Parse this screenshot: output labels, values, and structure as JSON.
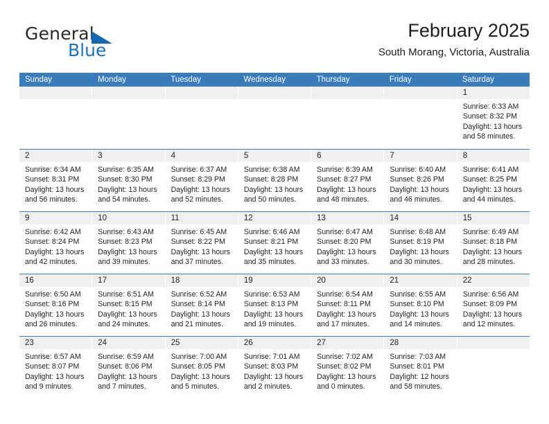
{
  "brand": {
    "word_general": "General",
    "word_blue": "Blue",
    "triangle_icon": "triangle-icon",
    "accent_color": "#1b72bb"
  },
  "header": {
    "title": "February 2025",
    "subtitle": "South Morang, Victoria, Australia"
  },
  "calendar": {
    "header_bg": "#3a7cba",
    "daynum_bg": "#efefef",
    "weekday_headers": [
      "Sunday",
      "Monday",
      "Tuesday",
      "Wednesday",
      "Thursday",
      "Friday",
      "Saturday"
    ],
    "weeks": [
      [
        {
          "day": "",
          "sunrise": "",
          "sunset": "",
          "daylight": "",
          "daylight2": ""
        },
        {
          "day": "",
          "sunrise": "",
          "sunset": "",
          "daylight": "",
          "daylight2": ""
        },
        {
          "day": "",
          "sunrise": "",
          "sunset": "",
          "daylight": "",
          "daylight2": ""
        },
        {
          "day": "",
          "sunrise": "",
          "sunset": "",
          "daylight": "",
          "daylight2": ""
        },
        {
          "day": "",
          "sunrise": "",
          "sunset": "",
          "daylight": "",
          "daylight2": ""
        },
        {
          "day": "",
          "sunrise": "",
          "sunset": "",
          "daylight": "",
          "daylight2": ""
        },
        {
          "day": "1",
          "sunrise": "Sunrise: 6:33 AM",
          "sunset": "Sunset: 8:32 PM",
          "daylight": "Daylight: 13 hours",
          "daylight2": "and 58 minutes."
        }
      ],
      [
        {
          "day": "2",
          "sunrise": "Sunrise: 6:34 AM",
          "sunset": "Sunset: 8:31 PM",
          "daylight": "Daylight: 13 hours",
          "daylight2": "and 56 minutes."
        },
        {
          "day": "3",
          "sunrise": "Sunrise: 6:35 AM",
          "sunset": "Sunset: 8:30 PM",
          "daylight": "Daylight: 13 hours",
          "daylight2": "and 54 minutes."
        },
        {
          "day": "4",
          "sunrise": "Sunrise: 6:37 AM",
          "sunset": "Sunset: 8:29 PM",
          "daylight": "Daylight: 13 hours",
          "daylight2": "and 52 minutes."
        },
        {
          "day": "5",
          "sunrise": "Sunrise: 6:38 AM",
          "sunset": "Sunset: 8:28 PM",
          "daylight": "Daylight: 13 hours",
          "daylight2": "and 50 minutes."
        },
        {
          "day": "6",
          "sunrise": "Sunrise: 6:39 AM",
          "sunset": "Sunset: 8:27 PM",
          "daylight": "Daylight: 13 hours",
          "daylight2": "and 48 minutes."
        },
        {
          "day": "7",
          "sunrise": "Sunrise: 6:40 AM",
          "sunset": "Sunset: 8:26 PM",
          "daylight": "Daylight: 13 hours",
          "daylight2": "and 46 minutes."
        },
        {
          "day": "8",
          "sunrise": "Sunrise: 6:41 AM",
          "sunset": "Sunset: 8:25 PM",
          "daylight": "Daylight: 13 hours",
          "daylight2": "and 44 minutes."
        }
      ],
      [
        {
          "day": "9",
          "sunrise": "Sunrise: 6:42 AM",
          "sunset": "Sunset: 8:24 PM",
          "daylight": "Daylight: 13 hours",
          "daylight2": "and 42 minutes."
        },
        {
          "day": "10",
          "sunrise": "Sunrise: 6:43 AM",
          "sunset": "Sunset: 8:23 PM",
          "daylight": "Daylight: 13 hours",
          "daylight2": "and 39 minutes."
        },
        {
          "day": "11",
          "sunrise": "Sunrise: 6:45 AM",
          "sunset": "Sunset: 8:22 PM",
          "daylight": "Daylight: 13 hours",
          "daylight2": "and 37 minutes."
        },
        {
          "day": "12",
          "sunrise": "Sunrise: 6:46 AM",
          "sunset": "Sunset: 8:21 PM",
          "daylight": "Daylight: 13 hours",
          "daylight2": "and 35 minutes."
        },
        {
          "day": "13",
          "sunrise": "Sunrise: 6:47 AM",
          "sunset": "Sunset: 8:20 PM",
          "daylight": "Daylight: 13 hours",
          "daylight2": "and 33 minutes."
        },
        {
          "day": "14",
          "sunrise": "Sunrise: 6:48 AM",
          "sunset": "Sunset: 8:19 PM",
          "daylight": "Daylight: 13 hours",
          "daylight2": "and 30 minutes."
        },
        {
          "day": "15",
          "sunrise": "Sunrise: 6:49 AM",
          "sunset": "Sunset: 8:18 PM",
          "daylight": "Daylight: 13 hours",
          "daylight2": "and 28 minutes."
        }
      ],
      [
        {
          "day": "16",
          "sunrise": "Sunrise: 6:50 AM",
          "sunset": "Sunset: 8:16 PM",
          "daylight": "Daylight: 13 hours",
          "daylight2": "and 26 minutes."
        },
        {
          "day": "17",
          "sunrise": "Sunrise: 6:51 AM",
          "sunset": "Sunset: 8:15 PM",
          "daylight": "Daylight: 13 hours",
          "daylight2": "and 24 minutes."
        },
        {
          "day": "18",
          "sunrise": "Sunrise: 6:52 AM",
          "sunset": "Sunset: 8:14 PM",
          "daylight": "Daylight: 13 hours",
          "daylight2": "and 21 minutes."
        },
        {
          "day": "19",
          "sunrise": "Sunrise: 6:53 AM",
          "sunset": "Sunset: 8:13 PM",
          "daylight": "Daylight: 13 hours",
          "daylight2": "and 19 minutes."
        },
        {
          "day": "20",
          "sunrise": "Sunrise: 6:54 AM",
          "sunset": "Sunset: 8:11 PM",
          "daylight": "Daylight: 13 hours",
          "daylight2": "and 17 minutes."
        },
        {
          "day": "21",
          "sunrise": "Sunrise: 6:55 AM",
          "sunset": "Sunset: 8:10 PM",
          "daylight": "Daylight: 13 hours",
          "daylight2": "and 14 minutes."
        },
        {
          "day": "22",
          "sunrise": "Sunrise: 6:56 AM",
          "sunset": "Sunset: 8:09 PM",
          "daylight": "Daylight: 13 hours",
          "daylight2": "and 12 minutes."
        }
      ],
      [
        {
          "day": "23",
          "sunrise": "Sunrise: 6:57 AM",
          "sunset": "Sunset: 8:07 PM",
          "daylight": "Daylight: 13 hours",
          "daylight2": "and 9 minutes."
        },
        {
          "day": "24",
          "sunrise": "Sunrise: 6:59 AM",
          "sunset": "Sunset: 8:06 PM",
          "daylight": "Daylight: 13 hours",
          "daylight2": "and 7 minutes."
        },
        {
          "day": "25",
          "sunrise": "Sunrise: 7:00 AM",
          "sunset": "Sunset: 8:05 PM",
          "daylight": "Daylight: 13 hours",
          "daylight2": "and 5 minutes."
        },
        {
          "day": "26",
          "sunrise": "Sunrise: 7:01 AM",
          "sunset": "Sunset: 8:03 PM",
          "daylight": "Daylight: 13 hours",
          "daylight2": "and 2 minutes."
        },
        {
          "day": "27",
          "sunrise": "Sunrise: 7:02 AM",
          "sunset": "Sunset: 8:02 PM",
          "daylight": "Daylight: 13 hours",
          "daylight2": "and 0 minutes."
        },
        {
          "day": "28",
          "sunrise": "Sunrise: 7:03 AM",
          "sunset": "Sunset: 8:01 PM",
          "daylight": "Daylight: 12 hours",
          "daylight2": "and 58 minutes."
        },
        {
          "day": "",
          "sunrise": "",
          "sunset": "",
          "daylight": "",
          "daylight2": ""
        }
      ]
    ]
  }
}
